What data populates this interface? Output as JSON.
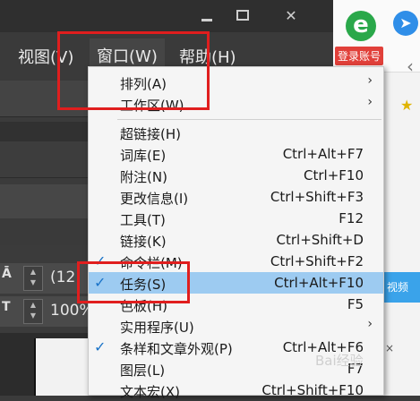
{
  "app": {
    "menubar": {
      "view": "视图(V)",
      "window": "窗口(W)",
      "help": "帮助(H)"
    },
    "controls": {
      "row1_value": "(12",
      "row2_value": "100%"
    }
  },
  "browser": {
    "login_label": "登录账号",
    "video_label": "视频"
  },
  "window_menu": {
    "items": [
      {
        "label": "排列(A)",
        "shortcut": "",
        "submenu": true,
        "checked": false,
        "highlighted": false
      },
      {
        "label": "工作区(W)",
        "shortcut": "",
        "submenu": true,
        "checked": false,
        "highlighted": false
      },
      {
        "label": "超链接(H)",
        "shortcut": "",
        "submenu": false,
        "checked": false,
        "highlighted": false
      },
      {
        "label": "词库(E)",
        "shortcut": "Ctrl+Alt+F7",
        "submenu": false,
        "checked": false,
        "highlighted": false
      },
      {
        "label": "附注(N)",
        "shortcut": "Ctrl+F10",
        "submenu": false,
        "checked": false,
        "highlighted": false
      },
      {
        "label": "更改信息(I)",
        "shortcut": "Ctrl+Shift+F3",
        "submenu": false,
        "checked": false,
        "highlighted": false
      },
      {
        "label": "工具(T)",
        "shortcut": "F12",
        "submenu": false,
        "checked": false,
        "highlighted": false
      },
      {
        "label": "链接(K)",
        "shortcut": "Ctrl+Shift+D",
        "submenu": false,
        "checked": false,
        "highlighted": false
      },
      {
        "label": "命令栏(M)",
        "shortcut": "Ctrl+Shift+F2",
        "submenu": false,
        "checked": true,
        "highlighted": false
      },
      {
        "label": "任务(S)",
        "shortcut": "Ctrl+Alt+F10",
        "submenu": false,
        "checked": true,
        "highlighted": true
      },
      {
        "label": "色板(H)",
        "shortcut": "F5",
        "submenu": false,
        "checked": false,
        "highlighted": false
      },
      {
        "label": "实用程序(U)",
        "shortcut": "",
        "submenu": true,
        "checked": false,
        "highlighted": false
      },
      {
        "label": "条样和文章外观(P)",
        "shortcut": "Ctrl+Alt+F6",
        "submenu": false,
        "checked": true,
        "highlighted": false
      },
      {
        "label": "图层(L)",
        "shortcut": "F7",
        "submenu": false,
        "checked": false,
        "highlighted": false
      },
      {
        "label": "文本宏(X)",
        "shortcut": "Ctrl+Shift+F10",
        "submenu": false,
        "checked": false,
        "highlighted": false
      }
    ]
  },
  "icons": {
    "minimize": "minimize-icon",
    "maximize": "maximize-icon",
    "close": "close-icon",
    "checkmark": "checkmark-icon",
    "submenu_arrow": "chevron-right-icon"
  },
  "colors": {
    "highlight": "#9dcbf1",
    "check": "#1a73c8",
    "annotation_red": "#e01e1e"
  },
  "watermark": "Bai经验"
}
